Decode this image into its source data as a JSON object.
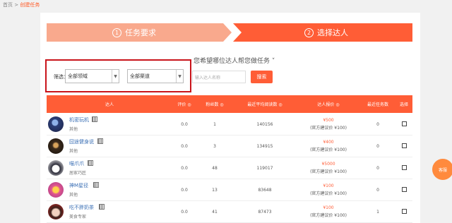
{
  "breadcrumb": {
    "home": "首页",
    "sep": ">",
    "current": "创建任务"
  },
  "steps": [
    {
      "num": "1",
      "label": "任务要求"
    },
    {
      "num": "2",
      "label": "选择达人"
    }
  ],
  "question": "您希望哪位达人帮您做任务 ˅",
  "filter": {
    "label": "筛选：",
    "field_select": "全部领域",
    "channel_select": "全部渠道",
    "search_placeholder": "输入达人名称",
    "search_button": "搜索"
  },
  "table": {
    "headers": [
      "达人",
      "评价 ◎",
      "粉丝数 ◎",
      "最近平均阅读数 ◎",
      "达人报价 ◎",
      "最近任务数",
      "选择"
    ],
    "rows": [
      {
        "name": "机密玩机",
        "category": "其他",
        "rating": "0.0",
        "fans": "1",
        "reads": "140156",
        "price": "¥500",
        "suggest": "(官方建议价 ¥100)",
        "tasks": "0"
      },
      {
        "name": "囧途健身说",
        "category": "其他",
        "rating": "0.0",
        "fans": "3",
        "reads": "134915",
        "price": "¥400",
        "suggest": "(官方建议价 ¥100)",
        "tasks": "0"
      },
      {
        "name": "喵爪爪",
        "category": "居家巧匠",
        "rating": "0.0",
        "fans": "48",
        "reads": "119017",
        "price": "¥5000",
        "suggest": "(官方建议价 ¥100)",
        "tasks": "0"
      },
      {
        "name": "神M星径",
        "category": "其他",
        "rating": "0.0",
        "fans": "13",
        "reads": "83648",
        "price": "¥100",
        "suggest": "(官方建议价 ¥100)",
        "tasks": "0"
      },
      {
        "name": "吃不胖奶茶",
        "category": "美食专家",
        "rating": "0.0",
        "fans": "41",
        "reads": "87473",
        "price": "¥100",
        "suggest": "(官方建议价 ¥100)",
        "tasks": "1"
      }
    ]
  },
  "float_button": "客服",
  "colors": {
    "accent": "#ff5d36",
    "highlight_box": "#c9141b",
    "link": "#3a6fb5"
  }
}
